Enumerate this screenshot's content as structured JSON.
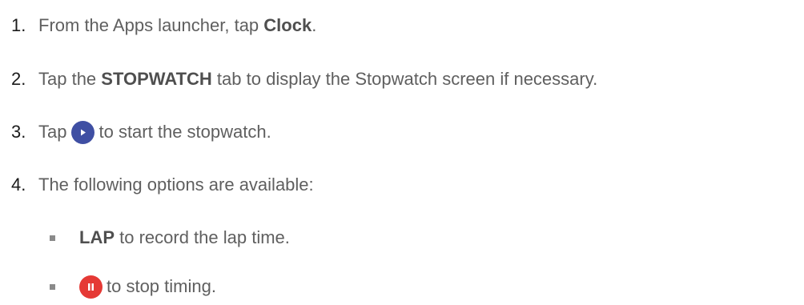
{
  "steps": [
    {
      "number": "1.",
      "pre": "From the Apps launcher, tap ",
      "bold": "Clock",
      "post": "."
    },
    {
      "number": "2.",
      "pre": "Tap the ",
      "bold": "STOPWATCH",
      "post": " tab to display the Stopwatch screen if necessary."
    },
    {
      "number": "3.",
      "pre": "Tap",
      "icon": "play-icon",
      "post": "to start the stopwatch."
    },
    {
      "number": "4.",
      "text": "The following options are available:"
    }
  ],
  "options": [
    {
      "bold": "LAP",
      "text": " to record the lap time."
    },
    {
      "icon": "pause-icon",
      "text": "to stop timing."
    }
  ],
  "colors": {
    "play_button": "#3f4fa3",
    "pause_button": "#e53935",
    "text": "#5f5f5f"
  }
}
